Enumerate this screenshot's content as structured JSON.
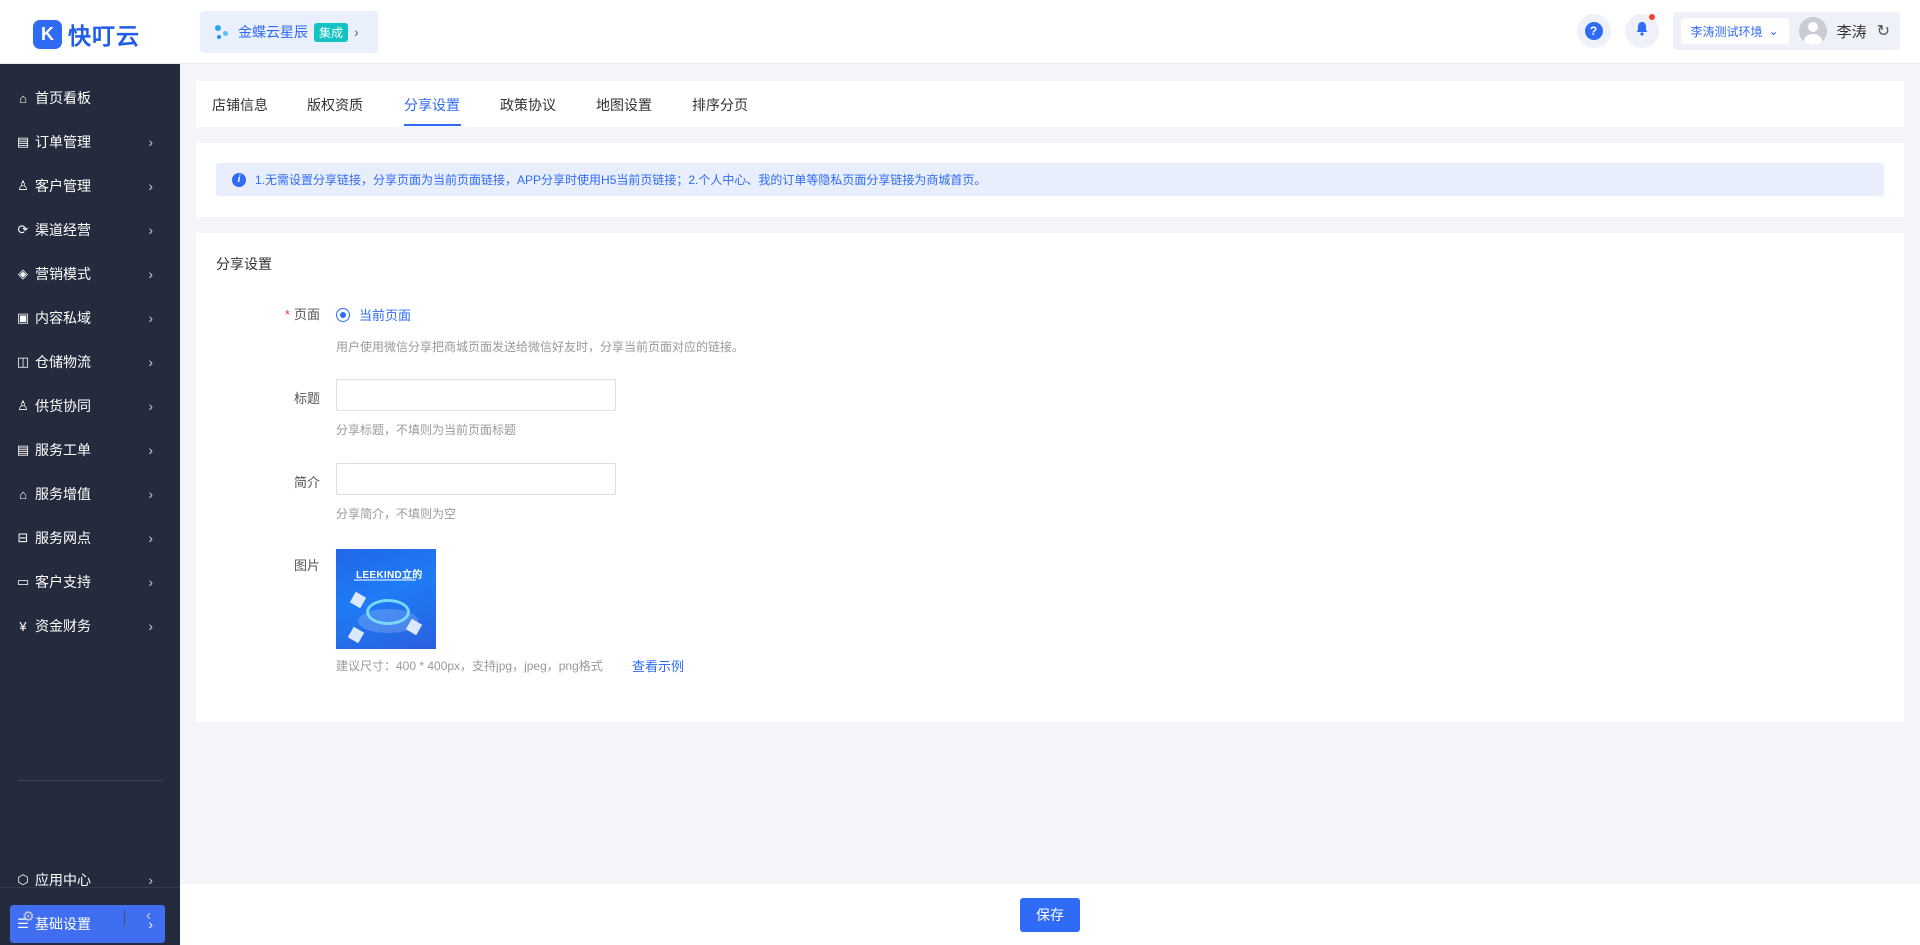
{
  "app": {
    "logo_glyph": "K",
    "logo_text": "快叮云",
    "accent": "#2f6bf5"
  },
  "org": {
    "name": "金蝶云星辰",
    "tag": "集成",
    "arrow": "›"
  },
  "header": {
    "help_glyph": "?",
    "bell_glyph": "🔔",
    "env_label": "李涛测试环境",
    "env_chevron": "⌄",
    "user_name": "李涛",
    "refresh_glyph": "↻"
  },
  "sidebar": {
    "items": [
      {
        "icon": "⌂",
        "label": "首页看板",
        "chevron": ""
      },
      {
        "icon": "▤",
        "label": "订单管理",
        "chevron": "›"
      },
      {
        "icon": "♙",
        "label": "客户管理",
        "chevron": "›"
      },
      {
        "icon": "⟳",
        "label": "渠道经营",
        "chevron": "›"
      },
      {
        "icon": "◈",
        "label": "营销模式",
        "chevron": "›"
      },
      {
        "icon": "▣",
        "label": "内容私域",
        "chevron": "›"
      },
      {
        "icon": "◫",
        "label": "仓储物流",
        "chevron": "›"
      },
      {
        "icon": "♙",
        "label": "供货协同",
        "chevron": "›"
      },
      {
        "icon": "▤",
        "label": "服务工单",
        "chevron": "›"
      },
      {
        "icon": "⌂",
        "label": "服务增值",
        "chevron": "›"
      },
      {
        "icon": "⊟",
        "label": "服务网点",
        "chevron": "›"
      },
      {
        "icon": "▭",
        "label": "客户支持",
        "chevron": "›"
      },
      {
        "icon": "¥",
        "label": "资金财务",
        "chevron": "›"
      }
    ],
    "app_center": {
      "icon": "⬡",
      "label": "应用中心",
      "chevron": "›"
    },
    "basic_settings": {
      "icon": "☰",
      "label": "基础设置",
      "chevron": "›"
    },
    "settings_glyph": "⚙",
    "collapse_glyph": "‹"
  },
  "tabs": [
    "店铺信息",
    "版权资质",
    "分享设置",
    "政策协议",
    "地图设置",
    "排序分页"
  ],
  "active_tab": "分享设置",
  "notice": {
    "icon": "i",
    "text": "1.无需设置分享链接，分享页面为当前页面链接，APP分享时使用H5当前页链接；2.个人中心、我的订单等隐私页面分享链接为商城首页。"
  },
  "form": {
    "section_title": "分享设置",
    "page_label": "页面",
    "required_mark": "*",
    "page_option": "当前页面",
    "page_hint": "用户使用微信分享把商城页面发送给微信好友时，分享当前页面对应的链接。",
    "title_label": "标题",
    "title_value": "",
    "title_hint": "分享标题，不填则为当前页面标题",
    "intro_label": "简介",
    "intro_value": "",
    "intro_hint": "分享简介，不填则为空",
    "image_label": "图片",
    "image_brand": "LEEKIND立的",
    "image_hint": "建议尺寸：400 * 400px，支持jpg，jpeg，png格式",
    "example_link": "查看示例"
  },
  "footer": {
    "save_label": "保存"
  }
}
